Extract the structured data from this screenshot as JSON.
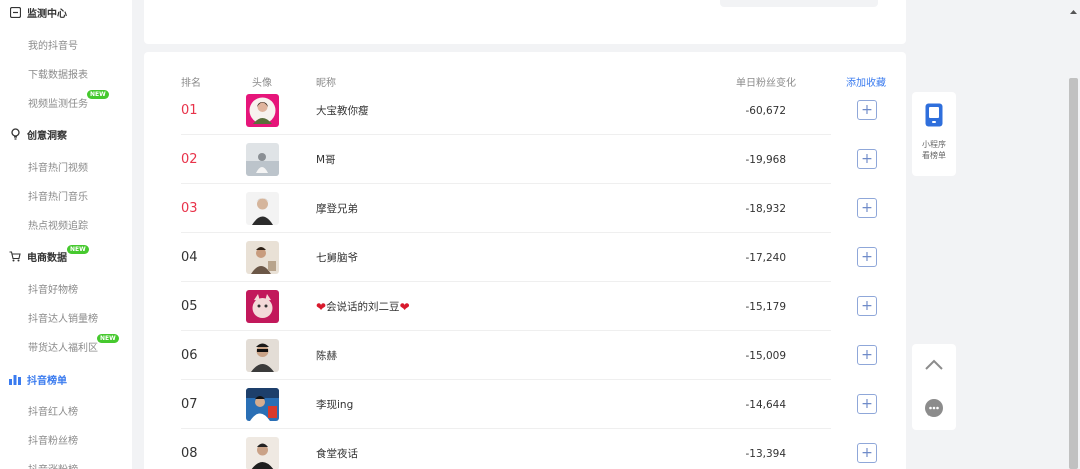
{
  "sidebar": {
    "sections": [
      {
        "title": "监测中心",
        "items": [
          "我的抖音号",
          "下载数据报表",
          "视频监测任务"
        ]
      },
      {
        "title": "创意洞察",
        "items": [
          "抖音热门视频",
          "抖音热门音乐",
          "热点视频追踪"
        ]
      },
      {
        "title": "电商数据",
        "items": [
          "抖音好物榜",
          "抖音达人销量榜",
          "带货达人福利区"
        ]
      },
      {
        "title": "抖音榜单",
        "items": [
          "抖音红人榜",
          "抖音粉丝榜",
          "抖音涨粉榜"
        ]
      }
    ],
    "new_badge": "NEW"
  },
  "table": {
    "headers": {
      "rank": "排名",
      "avatar": "头像",
      "nickname": "昵称",
      "change": "单日粉丝变化",
      "add": "添加收藏"
    },
    "rows": [
      {
        "rank": "01",
        "nickname": "大宝教你瘦",
        "change": "-60,672"
      },
      {
        "rank": "02",
        "nickname": "M哥",
        "change": "-19,968"
      },
      {
        "rank": "03",
        "nickname": "摩登兄弟",
        "change": "-18,932"
      },
      {
        "rank": "04",
        "nickname": "七舅脑爷",
        "change": "-17,240"
      },
      {
        "rank": "05",
        "nickname": "会说话的刘二豆",
        "change": "-15,179"
      },
      {
        "rank": "06",
        "nickname": "陈赫",
        "change": "-15,009"
      },
      {
        "rank": "07",
        "nickname": "李现ing",
        "change": "-14,644"
      },
      {
        "rank": "08",
        "nickname": "食堂夜话",
        "change": "-13,394"
      }
    ],
    "add_symbol": "+"
  },
  "right_panel": {
    "miniprogram_line1": "小程序",
    "miniprogram_line2": "看榜单"
  },
  "colors": {
    "accent": "#3a7bef",
    "top_rank": "#e8334a",
    "badge": "#46c92e"
  }
}
